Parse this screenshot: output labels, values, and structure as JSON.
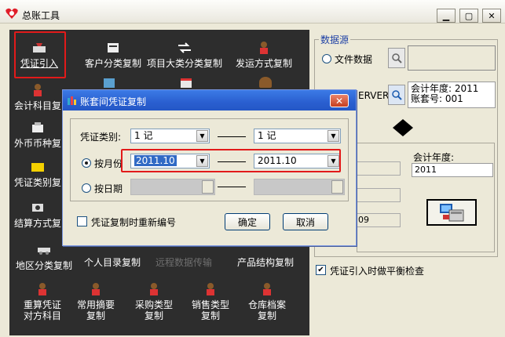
{
  "window": {
    "title": "总账工具"
  },
  "tools": {
    "row1": [
      "凭证引入",
      "客户分类复制",
      "项目大类分类复制",
      "发运方式复制"
    ],
    "col1": [
      "会计科目复",
      "外币币种复",
      "凭证类别复",
      "结算方式复"
    ],
    "row6": [
      "地区分类复制",
      "个人目录复制",
      "远程数据传输",
      "产品结构复制"
    ],
    "row7": [
      [
        "重算凭证",
        "对方科目"
      ],
      [
        "常用摘要",
        "复制"
      ],
      [
        "采购类型",
        "复制"
      ],
      [
        "销售类型",
        "复制"
      ],
      [
        "仓库档案",
        "复制"
      ]
    ]
  },
  "datasource": {
    "label": "数据源",
    "file_option": "文件数据",
    "server_text": "ERVER",
    "info_lines": [
      "会计年度: 2011",
      "账套号: 001"
    ],
    "year_label": "会计年度:",
    "year_value": "2011",
    "partial_value": "09"
  },
  "dialog": {
    "title": "账套间凭证复制",
    "voucher_label": "凭证类别:",
    "voucher_from": "1  记",
    "voucher_to": "1  记",
    "month_label": "按月份",
    "month_from": "2011.10",
    "month_to": "2011.10",
    "date_label": "按日期",
    "renumber_label": "凭证复制时重新编号",
    "ok": "确定",
    "cancel": "取消"
  },
  "balance_check": "凭证引入时做平衡检查",
  "colors": {
    "highlight": "#e21a1a",
    "dark_panel": "#2d2d2d",
    "title_blue": "#2a5fd0"
  }
}
